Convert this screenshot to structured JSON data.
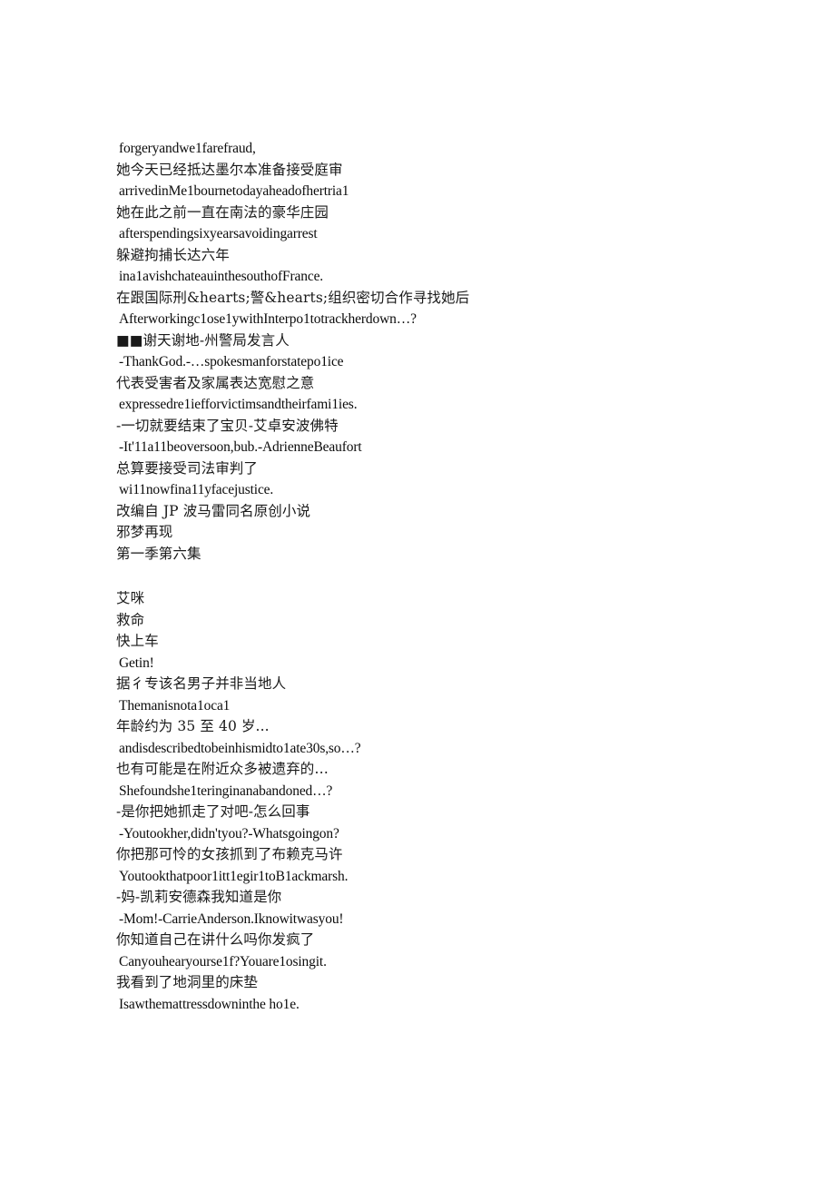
{
  "document": {
    "kind": "subtitle-transcript-page",
    "background_color": "#ffffff",
    "text_color": "#111111",
    "blocks": [
      {
        "id": "block-1",
        "lines": [
          {
            "script": "latin",
            "text": "forgeryandwe1farefraud,"
          },
          {
            "script": "cjk",
            "text": "她今天已经抵达墨尔本准备接受庭审"
          },
          {
            "script": "latin",
            "text": "arrivedinMe1bournetodayaheadofhertria1"
          },
          {
            "script": "cjk",
            "text": "她在此之前一直在南法的豪华庄园"
          },
          {
            "script": "latin",
            "text": "afterspendingsixyearsavoidingarrest"
          },
          {
            "script": "cjk",
            "text": "躲避拘捕长达六年"
          },
          {
            "script": "latin",
            "text": "ina1avishchateauinthesouthofFrance."
          },
          {
            "script": "cjk",
            "text": "在跟国际刑&hearts;警&hearts;组织密切合作寻找她后"
          },
          {
            "script": "latin",
            "text": "Afterworkingc1ose1ywithInterpo1totrackherdown…?"
          },
          {
            "script": "cjk",
            "text": "■■谢天谢地-州警局发言人"
          },
          {
            "script": "latin",
            "text": "-ThankGod.-…spokesmanforstatepo1ice"
          },
          {
            "script": "cjk",
            "text": "代表受害者及家属表达宽慰之意"
          },
          {
            "script": "latin",
            "text": "expressedre1iefforvictimsandtheirfami1ies."
          },
          {
            "script": "cjk",
            "text": "-一切就要结束了宝贝-艾卓安波佛特"
          },
          {
            "script": "latin",
            "text": "-It'11a11beoversoon,bub.-AdrienneBeaufort"
          },
          {
            "script": "cjk",
            "text": "总算要接受司法审判了"
          },
          {
            "script": "latin",
            "text": "wi11nowfina11yfacejustice."
          },
          {
            "script": "cjk",
            "text": "改编自 JP 波马雷同名原创小说"
          },
          {
            "script": "cjk",
            "text": "邪梦再现"
          },
          {
            "script": "cjk",
            "text": "第一季第六集"
          }
        ]
      },
      {
        "id": "block-2",
        "lines": [
          {
            "script": "cjk",
            "text": "艾咪"
          },
          {
            "script": "cjk",
            "text": "救命"
          },
          {
            "script": "cjk",
            "text": "快上车"
          },
          {
            "script": "latin",
            "text": "Getin!"
          },
          {
            "script": "cjk",
            "text": "据彳专该名男子并非当地人"
          },
          {
            "script": "latin",
            "text": "Themanisnota1oca1"
          },
          {
            "script": "cjk",
            "text": "年龄约为 35 至 40 岁..."
          },
          {
            "script": "latin",
            "text": "andisdescribedtobeinhismidto1ate30s,so…?"
          },
          {
            "script": "cjk",
            "text": "也有可能是在附近众多被遗弃的…"
          },
          {
            "script": "latin",
            "text": "Shefoundshe1teringinanabandoned…?"
          },
          {
            "script": "cjk",
            "text": "-是你把她抓走了对吧-怎么回事"
          },
          {
            "script": "latin",
            "text": "-Youtookher,didn'tyou?-Whatsgoingon?"
          },
          {
            "script": "cjk",
            "text": "你把那可怜的女孩抓到了布赖克马许"
          },
          {
            "script": "latin",
            "text": "Youtookthatpoor1itt1egir1toB1ackmarsh."
          },
          {
            "script": "cjk",
            "text": "-妈-凯莉安德森我知道是你"
          },
          {
            "script": "latin",
            "text": "-Mom!-CarrieAnderson.Iknowitwasyou!"
          },
          {
            "script": "cjk",
            "text": "你知道自己在讲什么吗你发疯了"
          },
          {
            "script": "latin",
            "text": "Canyouhearyourse1f?Youare1osingit."
          },
          {
            "script": "cjk",
            "text": "我看到了地洞里的床垫"
          },
          {
            "script": "latin",
            "text": "Isawthemattressdowninthe ho1e."
          }
        ]
      }
    ]
  }
}
